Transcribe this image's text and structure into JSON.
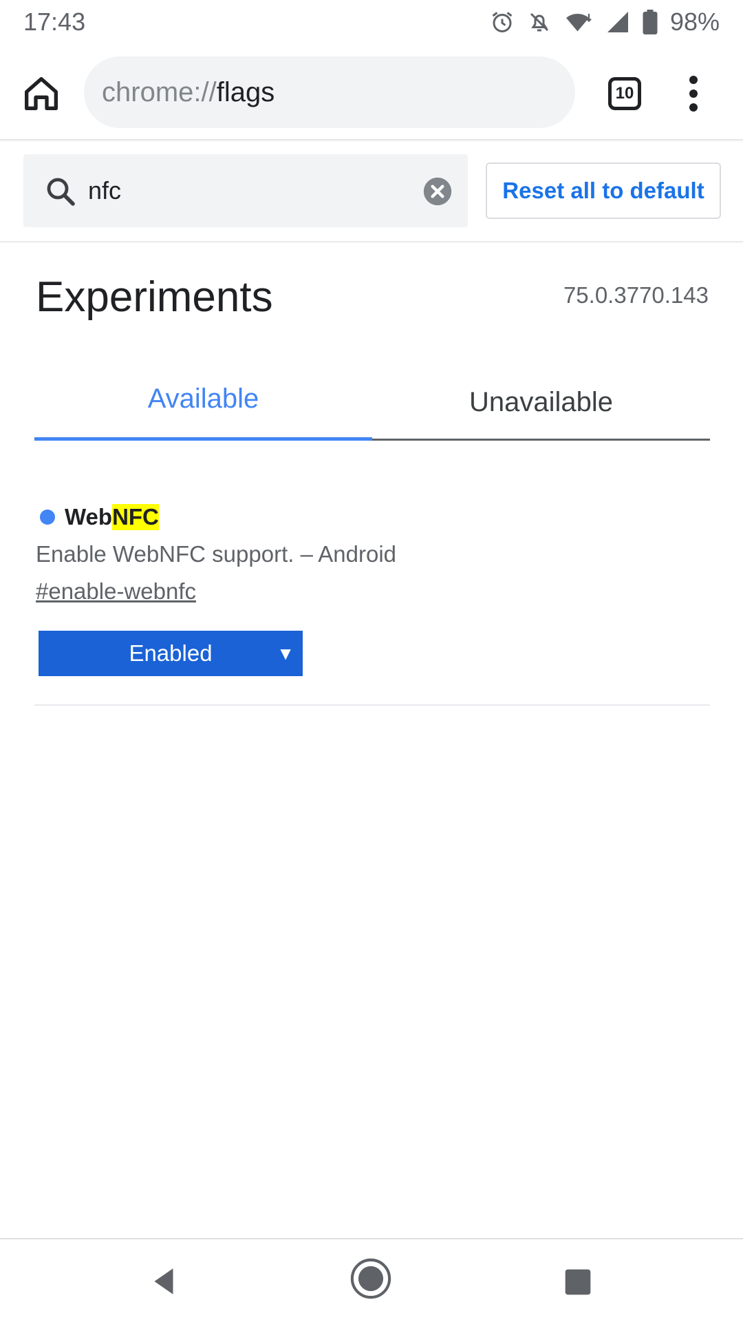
{
  "status_bar": {
    "time": "17:43",
    "battery": "98%",
    "icons": [
      "alarm-icon",
      "notifications-off-icon",
      "wifi-icon",
      "signal-icon",
      "battery-icon"
    ]
  },
  "toolbar": {
    "url_scheme": "chrome://",
    "url_path": "flags",
    "tab_count": "10",
    "icons": [
      "home-icon",
      "tab-switcher-icon",
      "overflow-menu-icon"
    ]
  },
  "search": {
    "value": "nfc",
    "reset_label": "Reset all to default"
  },
  "header": {
    "title": "Experiments",
    "version": "75.0.3770.143"
  },
  "tabs": [
    {
      "label": "Available",
      "selected": true
    },
    {
      "label": "Unavailable",
      "selected": false
    }
  ],
  "experiment": {
    "title_prefix": "Web",
    "title_highlight": "NFC",
    "description": "Enable WebNFC support. – Android",
    "link": "#enable-webnfc",
    "selected_option": "Enabled"
  },
  "colors": {
    "accent": "#4285f4",
    "link_button": "#1a73e8",
    "select_bg": "#1a62d6",
    "highlight": "#ffff00"
  }
}
